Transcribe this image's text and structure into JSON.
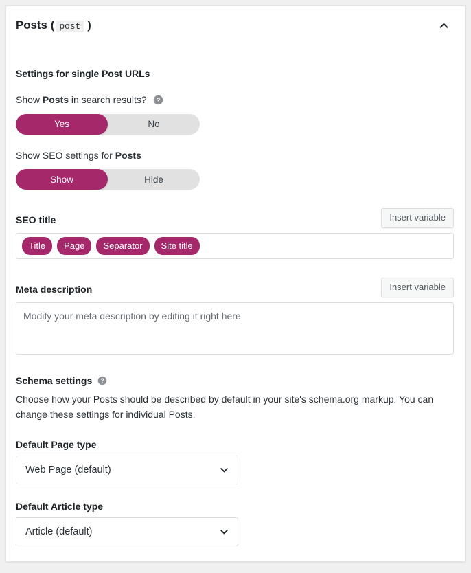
{
  "card": {
    "title_text": "Posts",
    "title_paren_open": "(",
    "title_code": "post",
    "title_paren_close": ")",
    "collapse_icon": "chevron-up-icon"
  },
  "section": {
    "heading": "Settings for single Post URLs"
  },
  "search_visibility": {
    "label_prefix": "Show ",
    "label_strong": "Posts",
    "label_suffix": " in search results?",
    "help_icon": "help-circle-icon",
    "options": [
      "Yes",
      "No"
    ],
    "selected": "Yes"
  },
  "seo_settings_visibility": {
    "label_prefix": "Show SEO settings for ",
    "label_strong": "Posts",
    "label_suffix": "",
    "options": [
      "Show",
      "Hide"
    ],
    "selected": "Show"
  },
  "seo_title": {
    "label": "SEO title",
    "insert_variable_label": "Insert variable",
    "pills": [
      "Title",
      "Page",
      "Separator",
      "Site title"
    ]
  },
  "meta_description": {
    "label": "Meta description",
    "insert_variable_label": "Insert variable",
    "value": "Modify your meta description by editing it right here",
    "placeholder": "Modify your meta description by editing it right here"
  },
  "schema": {
    "heading": "Schema settings",
    "help_icon": "help-circle-icon",
    "description": "Choose how your Posts should be described by default in your site's schema.org markup. You can change these settings for individual Posts.",
    "page_type": {
      "label": "Default Page type",
      "selected": "Web Page (default)",
      "chevron_icon": "chevron-down-icon"
    },
    "article_type": {
      "label": "Default Article type",
      "selected": "Article (default)",
      "chevron_icon": "chevron-down-icon"
    }
  },
  "colors": {
    "accent": "#a4286a",
    "track": "#e1e1e1",
    "border": "#dcdcde",
    "page_bg": "#f0f0f1",
    "text": "#2c3338"
  }
}
